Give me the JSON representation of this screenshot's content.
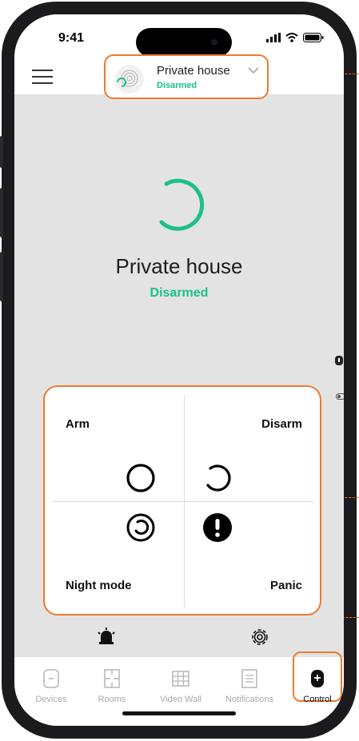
{
  "status_bar": {
    "time": "9:41"
  },
  "header": {
    "site_name": "Private house",
    "site_status": "Disarmed"
  },
  "main": {
    "title": "Private house",
    "status": "Disarmed"
  },
  "controls": [
    {
      "id": "arm",
      "label": "Arm",
      "icon": "circle-outline-icon"
    },
    {
      "id": "disarm",
      "label": "Disarm",
      "icon": "circle-open-icon"
    },
    {
      "id": "night",
      "label": "Night mode",
      "icon": "night-mode-icon"
    },
    {
      "id": "panic",
      "label": "Panic",
      "icon": "exclamation-circle-icon"
    }
  ],
  "tabs": [
    {
      "label": "Devices",
      "icon": "device-icon"
    },
    {
      "label": "Rooms",
      "icon": "room-icon"
    },
    {
      "label": "Video Wall",
      "icon": "grid-icon"
    },
    {
      "label": "Notifications",
      "icon": "notes-icon"
    },
    {
      "label": "Control",
      "icon": "control-icon",
      "active": true
    }
  ],
  "colors": {
    "accent": "#ee7a2c",
    "status_green": "#1cc08a",
    "background": "#e3e3e3"
  }
}
